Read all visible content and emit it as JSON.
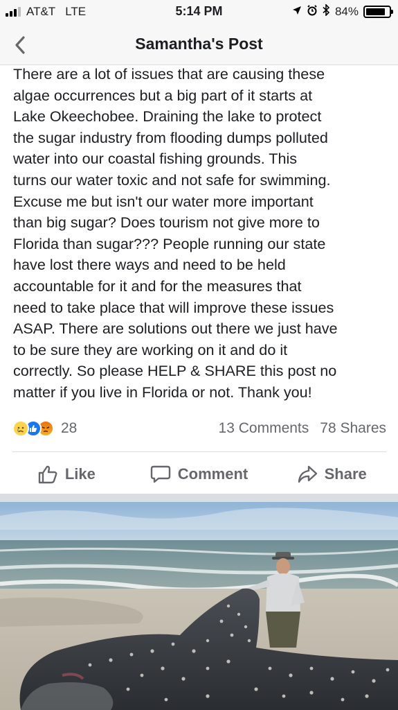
{
  "status_bar": {
    "carrier": "AT&T",
    "network": "LTE",
    "time": "5:14 PM",
    "battery": "84%",
    "battery_level": 0.84
  },
  "nav": {
    "title": "Samantha's Post",
    "back_icon": "chevron-left-icon"
  },
  "post": {
    "text": "There are a lot of issues that are causing these\nalgae occurrences but a big part of it starts at\nLake Okeechobee. Draining the lake to protect\nthe sugar industry from flooding dumps polluted\nwater into our coastal fishing grounds. This\nturns our water toxic and not safe for swimming.\nExcuse me but isn't our water more important\nthan big sugar? Does tourism not give more to\nFlorida than sugar??? People running our state\nhave lost there ways and need to be held\naccountable for it and for the measures that\nneed to take place that will improve these issues\nASAP. There are solutions out there we just have\nto be sure they are working on it and do it\ncorrectly. So please HELP & SHARE this post no\nmatter if you live in Florida or not. Thank you!"
  },
  "reactions": {
    "icons": [
      "sad-reaction-icon",
      "like-reaction-icon",
      "angry-reaction-icon"
    ],
    "count": "28",
    "comments": "13 Comments",
    "shares": "78 Shares"
  },
  "actions": {
    "like": "Like",
    "comment": "Comment",
    "share": "Share"
  },
  "colors": {
    "facebook_blue": "#1877f2",
    "secondary_text": "#65676b",
    "divider": "#dadde1"
  }
}
